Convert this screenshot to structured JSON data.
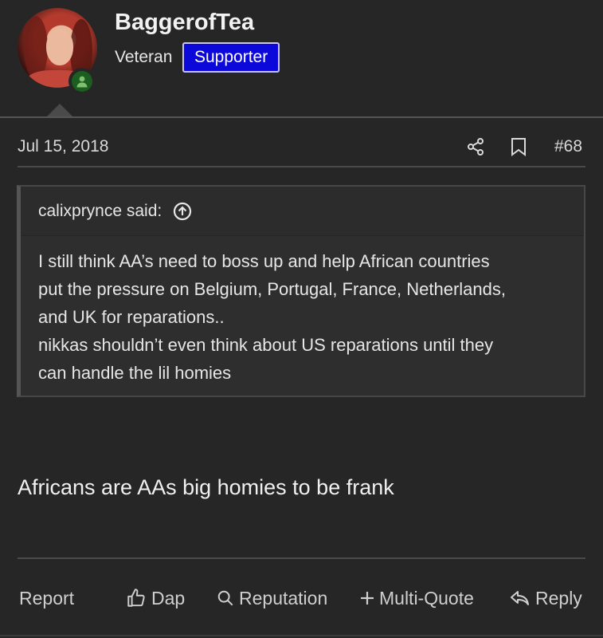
{
  "user": {
    "name": "BaggerofTea",
    "title": "Veteran",
    "badge": "Supporter"
  },
  "post": {
    "date": "Jul 15, 2018",
    "number": "#68",
    "message": "Africans are AAs big homies to be frank"
  },
  "quote": {
    "author": "calixprynce said:",
    "lines": [
      "I still think AA’s need to boss up and help African countries",
      "put the pressure on Belgium, Portugal, France, Netherlands,",
      "and UK for reparations..",
      "nikkas shouldn’t even think about US reparations until they",
      "can handle the lil homies"
    ]
  },
  "actions": {
    "report": "Report",
    "dap": "Dap",
    "reputation": "Reputation",
    "multiquote": "Multi-Quote",
    "reply": "Reply"
  },
  "colors": {
    "background": "#262626",
    "badge_bg": "#0c08d9",
    "online": "#1b5e20"
  }
}
